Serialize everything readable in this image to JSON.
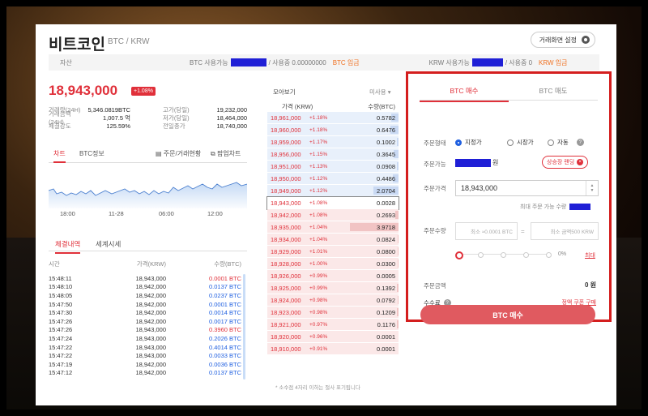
{
  "header": {
    "title": "비트코인",
    "subtitle": "BTC / KRW",
    "settings_label": "거래화면 설정"
  },
  "asset_bar": {
    "label": "자산",
    "btc_available_label": "BTC 사용가능",
    "btc_in_use": "/ 사용중 0.00000000",
    "btc_deposit": "BTC 입금",
    "krw_available_label": "KRW 사용가능",
    "krw_in_use": "/ 사용중 0",
    "krw_deposit": "KRW 입금"
  },
  "ticker": {
    "price": "18,943,000",
    "change": "+1.08%",
    "rows": [
      {
        "k1": "거래량(24H)",
        "v1": "5,346.0819BTC",
        "k2": "고가(당일)",
        "v2": "19,232,000"
      },
      {
        "k1": "거래금액(24H)",
        "v1": "1,007.5 억",
        "k2": "저가(당일)",
        "v2": "18,464,000"
      },
      {
        "k1": "체결강도",
        "v1": "125.59%",
        "k2": "전일종가",
        "v2": "18,740,000"
      }
    ]
  },
  "chart_tabs": {
    "chart": "차트",
    "info": "BTC정보",
    "orders": "주문/거래현황",
    "popup": "팝업차트"
  },
  "chart_axis": [
    "18:00",
    "11-28",
    "06:00",
    "12:00"
  ],
  "trade_tabs": {
    "trades": "체결내역",
    "world": "세계시세"
  },
  "trades": {
    "headers": [
      "시간",
      "가격(KRW)",
      "수량(BTC)"
    ],
    "rows": [
      {
        "t": "15:48:11",
        "p": "18,943,000",
        "q": "0.0001 BTC",
        "side": "buy"
      },
      {
        "t": "15:48:10",
        "p": "18,942,000",
        "q": "0.0137 BTC",
        "side": "sell"
      },
      {
        "t": "15:48:05",
        "p": "18,942,000",
        "q": "0.0237 BTC",
        "side": "sell"
      },
      {
        "t": "15:47:50",
        "p": "18,942,000",
        "q": "0.0001 BTC",
        "side": "sell"
      },
      {
        "t": "15:47:30",
        "p": "18,942,000",
        "q": "0.0014 BTC",
        "side": "sell"
      },
      {
        "t": "15:47:26",
        "p": "18,942,000",
        "q": "0.0017 BTC",
        "side": "sell"
      },
      {
        "t": "15:47:26",
        "p": "18,943,000",
        "q": "0.3960 BTC",
        "side": "buy"
      },
      {
        "t": "15:47:24",
        "p": "18,943,000",
        "q": "0.2026 BTC",
        "side": "sell"
      },
      {
        "t": "15:47:22",
        "p": "18,943,000",
        "q": "0.4014 BTC",
        "side": "sell"
      },
      {
        "t": "15:47:22",
        "p": "18,943,000",
        "q": "0.0033 BTC",
        "side": "sell"
      },
      {
        "t": "15:47:19",
        "p": "18,942,000",
        "q": "0.0036 BTC",
        "side": "sell"
      },
      {
        "t": "15:47:12",
        "p": "18,942,000",
        "q": "0.0137 BTC",
        "side": "sell"
      }
    ]
  },
  "orderbook": {
    "title": "모아보기",
    "unit_select": "미사용 ▾",
    "headers": [
      "가격 (KRW)",
      "수량(BTC)"
    ],
    "rows": [
      {
        "p": "18,961,000",
        "c": "+1.18%",
        "q": "0.5782",
        "type": "ask",
        "fill": 0.15
      },
      {
        "p": "18,960,000",
        "c": "+1.18%",
        "q": "0.6476",
        "type": "ask",
        "fill": 0.17
      },
      {
        "p": "18,959,000",
        "c": "+1.17%",
        "q": "0.1002",
        "type": "ask",
        "fill": 0.03
      },
      {
        "p": "18,956,000",
        "c": "+1.15%",
        "q": "0.3645",
        "type": "ask",
        "fill": 0.1
      },
      {
        "p": "18,951,000",
        "c": "+1.13%",
        "q": "0.0908",
        "type": "ask",
        "fill": 0.03
      },
      {
        "p": "18,950,000",
        "c": "+1.12%",
        "q": "0.4486",
        "type": "ask",
        "fill": 0.12
      },
      {
        "p": "18,949,000",
        "c": "+1.12%",
        "q": "2.0704",
        "type": "ask",
        "fill": 0.52
      },
      {
        "p": "18,943,000",
        "c": "+1.08%",
        "q": "0.0028",
        "type": "cur",
        "fill": 0
      },
      {
        "p": "18,942,000",
        "c": "+1.08%",
        "q": "0.2693",
        "type": "bid",
        "fill": 0.07
      },
      {
        "p": "18,935,000",
        "c": "+1.04%",
        "q": "3.9718",
        "type": "bid",
        "fill": 1
      },
      {
        "p": "18,934,000",
        "c": "+1.04%",
        "q": "0.0824",
        "type": "bid",
        "fill": 0.02
      },
      {
        "p": "18,929,000",
        "c": "+1.01%",
        "q": "0.0800",
        "type": "bid",
        "fill": 0.02
      },
      {
        "p": "18,928,000",
        "c": "+1.00%",
        "q": "0.0300",
        "type": "bid",
        "fill": 0.01
      },
      {
        "p": "18,926,000",
        "c": "+0.99%",
        "q": "0.0005",
        "type": "bid",
        "fill": 0
      },
      {
        "p": "18,925,000",
        "c": "+0.99%",
        "q": "0.1392",
        "type": "bid",
        "fill": 0.04
      },
      {
        "p": "18,924,000",
        "c": "+0.98%",
        "q": "0.0792",
        "type": "bid",
        "fill": 0.02
      },
      {
        "p": "18,923,000",
        "c": "+0.98%",
        "q": "0.1209",
        "type": "bid",
        "fill": 0.03
      },
      {
        "p": "18,921,000",
        "c": "+0.97%",
        "q": "0.1176",
        "type": "bid",
        "fill": 0.03
      },
      {
        "p": "18,920,000",
        "c": "+0.96%",
        "q": "0.0001",
        "type": "bid",
        "fill": 0
      },
      {
        "p": "18,910,000",
        "c": "+0.91%",
        "q": "0.0001",
        "type": "bid",
        "fill": 0
      }
    ],
    "footnote": "* 소수점 4자리 이하는 절사 표기됩니다"
  },
  "order_form": {
    "tab_buy": "BTC 매수",
    "tab_sell": "BTC 매도",
    "type_label": "주문형태",
    "type_limit": "지정가",
    "type_market": "시장가",
    "type_auto": "자동",
    "available_label": "주문가능",
    "available_unit": "원",
    "pill_label": "상승장 랜딩",
    "price_label": "주문가격",
    "price_value": "18,943,000",
    "max_qty_label": "최대 주문 가능 수량",
    "qty_label": "주문수량",
    "qty_min_placeholder": "최소 ≈0.0001  BTC",
    "amount_min_placeholder": "최소 금액500  KRW",
    "pct_label": "0%",
    "reset_label": "최대",
    "total_label": "주문금액",
    "total_value": "0 원",
    "fee_label": "수수료",
    "coupon_label": "정액 쿠폰 구매",
    "buy_button": "BTC 매수"
  },
  "colors": {
    "accent": "#e0303a",
    "ask": "#e8f0fb",
    "bid": "#fbe8e8",
    "highlight": "#d41e1e"
  }
}
